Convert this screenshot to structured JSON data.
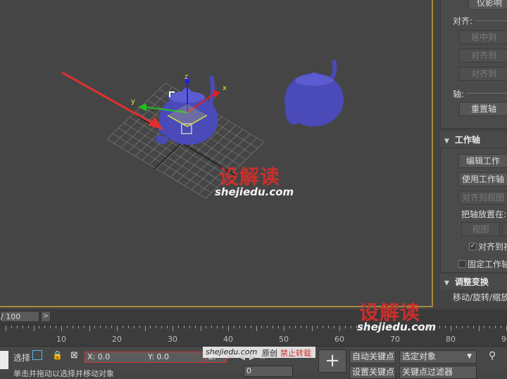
{
  "viewport": {
    "watermark_cn": "设解读",
    "watermark_url": "shejiedu.com",
    "gizmo_axes": {
      "x": "x",
      "y": "y",
      "z": "z"
    },
    "colors": {
      "background": "#454545",
      "teapot": "#4a4ab8",
      "arrow": "#e03030",
      "border": "#a78a3d"
    }
  },
  "panel": {
    "top_button": "仅影响",
    "align_label": "对齐:",
    "align_buttons": [
      "居中到",
      "对齐到",
      "对齐到"
    ],
    "axis_label": "轴:",
    "reset_button": "重置轴",
    "working_pivot": {
      "title": "工作轴",
      "edit_button": "编辑工作",
      "use_button": "使用工作轴",
      "align_view_button": "对齐到视图",
      "place_label": "把轴放置在:",
      "view_button": "视图",
      "align_check": "对齐到视",
      "lock_check": "固定工作轴"
    },
    "adjust_transform": {
      "title": "调整变换",
      "move_label": "移动/旋转/缩放"
    }
  },
  "timeslider": {
    "frame_text": "/ 100",
    "next_arrow": ">"
  },
  "ruler": {
    "labels": [
      "10",
      "20",
      "30",
      "40",
      "50",
      "60",
      "70",
      "80",
      "90"
    ]
  },
  "statusbar": {
    "select_label": "选择",
    "x_label": "X:",
    "x_value": "0.0",
    "y_label": "Y:",
    "y_value": "0.0",
    "z_label": "Z:",
    "auto_key": "自动关键点",
    "set_key": "设置关键点",
    "selected_dropdown": "选定对象",
    "key_filter": "关键点过滤器",
    "watermark_small": "shejiedu.com",
    "original_text": "原创",
    "forbid_text": "禁止转载",
    "bottom_hint": "单击并拖动以选择并移动对象",
    "frame_value": "0"
  },
  "watermark_bottom": {
    "cn": "设解读",
    "url": "shejiedu.com"
  }
}
